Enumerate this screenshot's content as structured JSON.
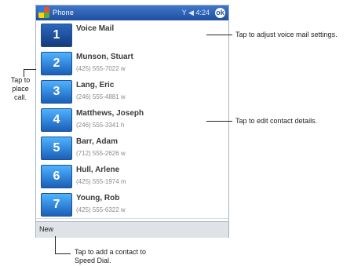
{
  "phone_app": {
    "title": "Phone",
    "status_icons": "Y ◀ 4:24",
    "ok_label": "ok",
    "speed_dial": [
      {
        "number": "1",
        "name": "Voice Mail",
        "phone": ""
      },
      {
        "number": "2",
        "name": "Munson, Stuart",
        "phone": "(425) 555-7022 w"
      },
      {
        "number": "3",
        "name": "Lang, Eric",
        "phone": "(246) 555-4881 w"
      },
      {
        "number": "4",
        "name": "Matthews, Joseph",
        "phone": "(246) 555-3341 h"
      },
      {
        "number": "5",
        "name": "Barr, Adam",
        "phone": "(712) 555-2626 w"
      },
      {
        "number": "6",
        "name": "Hull, Arlene",
        "phone": "(425) 555-1974 m"
      },
      {
        "number": "7",
        "name": "Young, Rob",
        "phone": "(425) 555-6322 w"
      }
    ],
    "menu_new": "New"
  },
  "callouts": {
    "tap_place_call": "Tap to\nplace\ncall.",
    "voicemail": "Tap to adjust voice mail settings.",
    "edit_contact": "Tap to edit contact details.",
    "add_contact": "Tap to add a contact to\nSpeed Dial."
  }
}
